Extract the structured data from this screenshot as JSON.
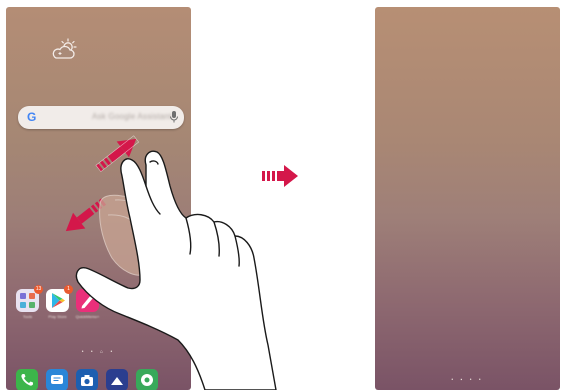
{
  "left_screen": {
    "weather_icon": "cloud-sun-icon",
    "search": {
      "logo": "G",
      "placeholder": "Ask Google Assistant",
      "mic_icon": "microphone-icon"
    },
    "apps": [
      {
        "icon": "folder-grid-icon",
        "label": "Tools",
        "badge": "13"
      },
      {
        "icon": "play-store-icon",
        "label": "Play Store",
        "badge": "1"
      },
      {
        "icon": "quick-memo-icon",
        "label": "QuickMemo+",
        "badge": ""
      }
    ],
    "page_indicator": "• • ⌂ •",
    "dock": [
      "phone-icon",
      "messages-icon",
      "camera-icon",
      "gallery-icon",
      "chrome-icon"
    ]
  },
  "right_screen": {
    "page_indicator": "• ▪ • •"
  },
  "gesture": {
    "type": "pinch-in",
    "arrows": [
      "up-right-arrow-icon",
      "down-left-arrow-icon"
    ]
  },
  "transition_arrow": {
    "icon": "right-arrow-icon",
    "color": "#d4174a"
  },
  "colors": {
    "wallpaper_top": "#b48d75",
    "wallpaper_bottom": "#7a5366",
    "arrow_accent": "#d4174a"
  }
}
